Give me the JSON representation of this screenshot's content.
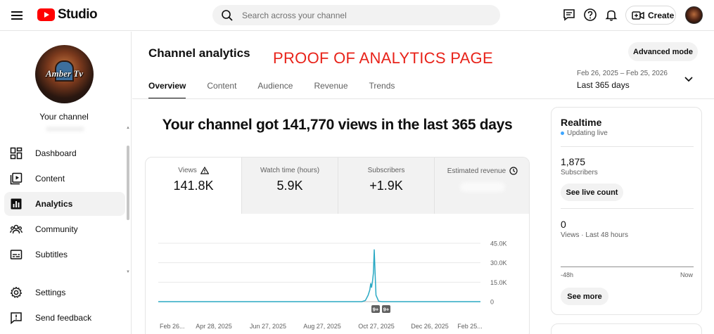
{
  "header": {
    "logo_text": "Studio",
    "search_placeholder": "Search across your channel",
    "create_label": "Create",
    "icons": [
      "menu-icon",
      "youtube-logo-icon",
      "search-icon",
      "comment-feedback-icon",
      "help-icon",
      "notifications-icon",
      "create-video-icon"
    ]
  },
  "sidebar": {
    "avatar_text": "Amber Tv",
    "your_channel_label": "Your channel",
    "items": [
      {
        "label": "Dashboard",
        "icon": "dashboard-icon"
      },
      {
        "label": "Content",
        "icon": "content-icon"
      },
      {
        "label": "Analytics",
        "icon": "analytics-icon",
        "active": true
      },
      {
        "label": "Community",
        "icon": "community-icon"
      },
      {
        "label": "Subtitles",
        "icon": "subtitles-icon"
      }
    ],
    "bottom_items": [
      {
        "label": "Settings",
        "icon": "settings-icon"
      },
      {
        "label": "Send feedback",
        "icon": "feedback-icon"
      }
    ]
  },
  "main": {
    "title": "Channel analytics",
    "annotation": "PROOF OF ANALYTICS PAGE",
    "advanced_mode_label": "Advanced mode",
    "tabs": [
      "Overview",
      "Content",
      "Audience",
      "Revenue",
      "Trends"
    ],
    "active_tab": "Overview",
    "date_range": {
      "dates": "Feb 26, 2025 – Feb 25, 2026",
      "label": "Last 365 days"
    },
    "headline": "Your channel got 141,770 views in the last 365 days",
    "metrics": [
      {
        "label": "Views",
        "value": "141.8K",
        "warning_icon": true,
        "selected": true
      },
      {
        "label": "Watch time (hours)",
        "value": "5.9K"
      },
      {
        "label": "Subscribers",
        "value": "+1.9K"
      },
      {
        "label": "Estimated revenue",
        "value": "",
        "clock_icon": true
      }
    ],
    "chart_badges": [
      "9+",
      "9+"
    ]
  },
  "chart_data": {
    "type": "line",
    "title": "",
    "xlabel": "",
    "ylabel": "",
    "y_ticks": [
      "45.0K",
      "30.0K",
      "15.0K",
      "0"
    ],
    "x_ticks": [
      "Feb 26...",
      "Apr 28, 2025",
      "Jun 27, 2025",
      "Aug 27, 2025",
      "Oct 27, 2025",
      "Dec 26, 2025",
      "Feb 25..."
    ],
    "ylim": [
      0,
      45000
    ],
    "series": [
      {
        "color": "#2aa9c4",
        "points": [
          [
            "2025-02-26",
            0
          ],
          [
            "2025-10-14",
            0
          ],
          [
            "2025-10-18",
            900
          ],
          [
            "2025-10-21",
            4800
          ],
          [
            "2025-10-23",
            9000
          ],
          [
            "2025-10-24",
            14000
          ],
          [
            "2025-10-25",
            11000
          ],
          [
            "2025-10-26",
            15500
          ],
          [
            "2025-10-27",
            22000
          ],
          [
            "2025-10-28",
            40000
          ],
          [
            "2025-10-29",
            21000
          ],
          [
            "2025-10-30",
            5000
          ],
          [
            "2025-11-02",
            300
          ],
          [
            "2025-11-06",
            0
          ],
          [
            "2026-02-25",
            0
          ]
        ]
      }
    ]
  },
  "realtime": {
    "title": "Realtime",
    "status": "Updating live",
    "subscribers_value": "1,875",
    "subscribers_label": "Subscribers",
    "see_live_count_label": "See live count",
    "views_value": "0",
    "views_label": "Views · Last 48 hours",
    "axis_start": "-48h",
    "axis_end": "Now",
    "see_more_label": "See more",
    "accent_color": "#3ea6ff"
  }
}
